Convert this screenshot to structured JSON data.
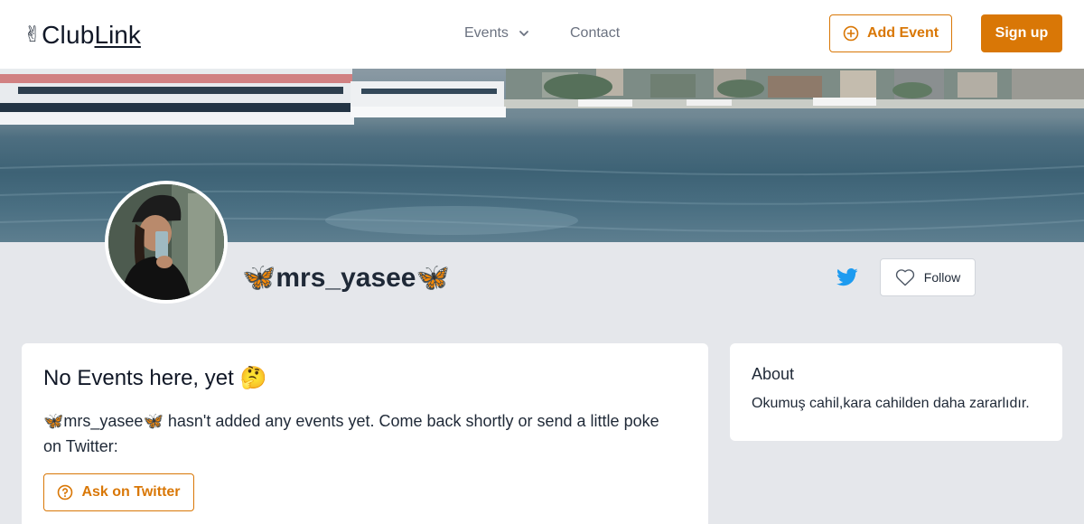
{
  "header": {
    "logo_emoji": "✌",
    "logo_club": "Club",
    "logo_link": "Link",
    "nav_events": "Events",
    "nav_contact": "Contact",
    "add_event_label": "Add Event",
    "signup_label": "Sign up"
  },
  "profile": {
    "name": "🦋mrs_yasee🦋",
    "follow_label": "Follow"
  },
  "events_card": {
    "title": "No Events here, yet 🤔",
    "message": "🦋mrs_yasee🦋 hasn't added any events yet. Come back shortly or send a little poke on Twitter:",
    "ask_label": "Ask on Twitter"
  },
  "about_card": {
    "title": "About",
    "text": "Okumuş cahil,kara cahilden daha zararlıdır."
  },
  "colors": {
    "accent": "#d97706",
    "twitter": "#1d9bf0",
    "page_bg": "#e5e7eb"
  },
  "icons": {
    "nav_dropdown": "chevron-down-icon",
    "add_event": "plus-circle-icon",
    "twitter": "twitter-icon",
    "follow": "heart-icon",
    "ask": "question-circle-icon"
  }
}
